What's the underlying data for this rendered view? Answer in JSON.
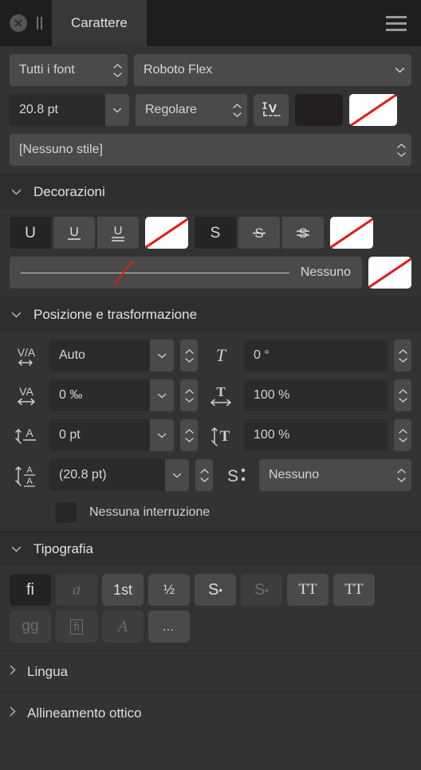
{
  "titlebar": {
    "close_label": "close-icon",
    "grip_label": "drag-handle",
    "tab_label": "Carattere",
    "menu_label": "menu-icon"
  },
  "font": {
    "collection_value": "Tutti i font",
    "family_value": "Roboto Flex",
    "size_value": "20.8 pt",
    "style_value": "Regolare",
    "variable_axes_label": "variable-font-icon",
    "fill_color": "#231f20",
    "stroke_color": "none",
    "paragraph_style_value": "[Nessuno stile]"
  },
  "decorations": {
    "title": "Decorazioni",
    "underline": [
      {
        "name": "underline-none",
        "glyph": "U",
        "active": true
      },
      {
        "name": "underline-single",
        "glyph": "U",
        "active": false
      },
      {
        "name": "underline-double",
        "glyph": "U",
        "active": false
      }
    ],
    "underline_color": "none",
    "strikethrough": [
      {
        "name": "strikethrough-none",
        "glyph": "S",
        "active": true
      },
      {
        "name": "strikethrough-single",
        "glyph": "S",
        "active": false
      },
      {
        "name": "strikethrough-double",
        "glyph": "S",
        "active": false
      }
    ],
    "strikethrough_color": "none",
    "line_style_value": "Nessuno",
    "line_style_color": "none"
  },
  "position": {
    "title": "Posizione e trasformazione",
    "kerning_icon": "kerning-icon",
    "kerning_value": "Auto",
    "tracking_icon": "tracking-icon",
    "tracking_value": "0 ‰",
    "baseline_icon": "baseline-shift-icon",
    "baseline_value": "0 pt",
    "leading_icon": "line-height-icon",
    "leading_value": "(20.8 pt)",
    "skew_icon": "skew-icon",
    "skew_value": "0 °",
    "hscale_icon": "horizontal-scale-icon",
    "hscale_value": "100 %",
    "vscale_icon": "vertical-scale-icon",
    "vscale_value": "100 %",
    "position_icon": "superscript-icon",
    "position_value": "Nessuno",
    "no_break_label": "Nessuna interruzione",
    "no_break_checked": false
  },
  "typography": {
    "title": "Tipografia",
    "row1": [
      {
        "name": "ligatures-standard",
        "glyph": "fi",
        "active": true,
        "disabled": false,
        "serif": false
      },
      {
        "name": "ligatures-discretionary",
        "glyph": "a",
        "active": false,
        "disabled": true,
        "serif": true
      },
      {
        "name": "ordinals",
        "glyph": "1st",
        "active": false,
        "disabled": false,
        "serif": false
      },
      {
        "name": "fractions",
        "glyph": "½",
        "active": false,
        "disabled": false,
        "serif": false
      },
      {
        "name": "superscript",
        "glyph": "S",
        "active": false,
        "disabled": false,
        "serif": false
      },
      {
        "name": "subscript",
        "glyph": "S",
        "active": false,
        "disabled": true,
        "serif": false
      },
      {
        "name": "all-caps",
        "glyph": "TT",
        "active": false,
        "disabled": false,
        "serif": true
      },
      {
        "name": "small-caps",
        "glyph": "TT",
        "active": false,
        "disabled": false,
        "serif": true
      }
    ],
    "row2": [
      {
        "name": "alternate-glyphs",
        "glyph": "gg",
        "active": false,
        "disabled": true,
        "serif": false
      },
      {
        "name": "glyph-panel",
        "glyph": "fi",
        "active": false,
        "disabled": true,
        "serif": false
      },
      {
        "name": "swash",
        "glyph": "A",
        "active": false,
        "disabled": true,
        "serif": true
      },
      {
        "name": "more-options",
        "glyph": "…",
        "active": false,
        "disabled": false,
        "serif": false
      }
    ]
  },
  "language": {
    "title": "Lingua"
  },
  "optical": {
    "title": "Allineamento ottico"
  }
}
